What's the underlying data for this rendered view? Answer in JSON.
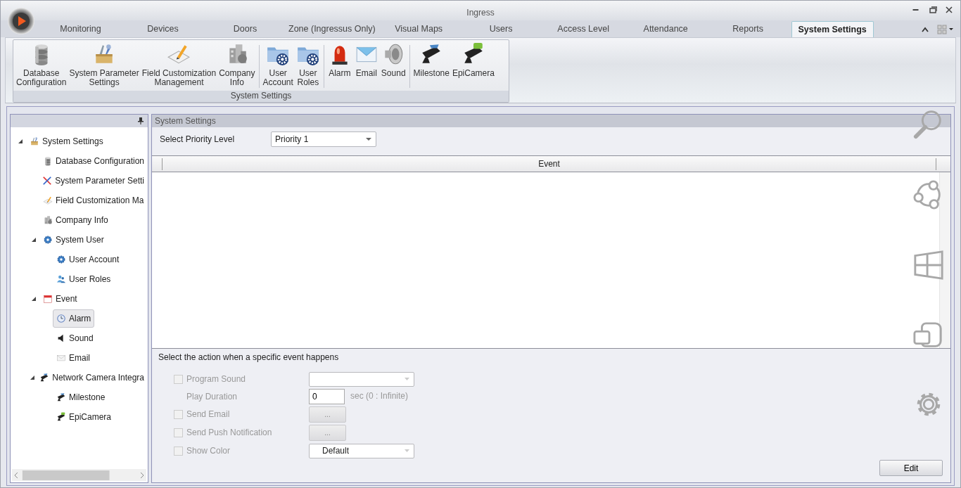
{
  "window": {
    "title": "Ingress"
  },
  "tabs": [
    {
      "label": "Monitoring",
      "selected": false
    },
    {
      "label": "Devices",
      "selected": false
    },
    {
      "label": "Doors",
      "selected": false
    },
    {
      "label": "Zone (Ingressus Only)",
      "selected": false
    },
    {
      "label": "Visual Maps",
      "selected": false
    },
    {
      "label": "Users",
      "selected": false
    },
    {
      "label": "Access Level",
      "selected": false
    },
    {
      "label": "Attendance",
      "selected": false
    },
    {
      "label": "Reports",
      "selected": false
    },
    {
      "label": "System Settings",
      "selected": true
    }
  ],
  "ribbon": {
    "groups": [
      {
        "items": [
          {
            "lines": [
              "Database",
              "Configuration"
            ]
          },
          {
            "lines": [
              "System Parameter",
              "Settings"
            ]
          },
          {
            "lines": [
              "Field Customization",
              "Management"
            ]
          },
          {
            "lines": [
              "Company",
              "Info"
            ]
          }
        ]
      },
      {
        "items": [
          {
            "lines": [
              "User",
              "Account"
            ]
          },
          {
            "lines": [
              "User",
              "Roles"
            ]
          }
        ]
      },
      {
        "items": [
          {
            "lines": [
              "Alarm"
            ]
          },
          {
            "lines": [
              "Email"
            ]
          },
          {
            "lines": [
              "Sound"
            ]
          }
        ]
      },
      {
        "items": [
          {
            "lines": [
              "Milestone"
            ]
          },
          {
            "lines": [
              "EpiCamera"
            ]
          }
        ]
      }
    ],
    "caption": "System Settings"
  },
  "tree": [
    {
      "label": "System Settings",
      "selected": false,
      "expanded": true,
      "children": [
        {
          "label": "Database Configuration",
          "selected": false
        },
        {
          "label": "System Parameter Setti",
          "selected": false
        },
        {
          "label": "Field Customization Ma",
          "selected": false
        },
        {
          "label": "Company Info",
          "selected": false
        },
        {
          "label": "System User",
          "selected": false,
          "expanded": true,
          "children": [
            {
              "label": "User Account",
              "selected": false
            },
            {
              "label": "User Roles",
              "selected": false
            }
          ]
        },
        {
          "label": "Event",
          "selected": false,
          "expanded": true,
          "children": [
            {
              "label": "Alarm",
              "selected": true
            },
            {
              "label": "Sound",
              "selected": false
            },
            {
              "label": "Email",
              "selected": false
            }
          ]
        },
        {
          "label": "Network Camera Integra",
          "selected": false,
          "expanded": true,
          "children": [
            {
              "label": "Milestone",
              "selected": false
            },
            {
              "label": "EpiCamera",
              "selected": false
            }
          ]
        }
      ]
    }
  ],
  "panel": {
    "title": "System Settings",
    "priority_label": "Select Priority Level",
    "priority_value": "Priority 1",
    "table": {
      "columns": [
        "Event"
      ]
    },
    "actions_heading": "Select the action when a specific event happens",
    "actions": [
      {
        "kind": "checkbox",
        "label": "Program Sound",
        "checked": false,
        "disabled": true,
        "control": {
          "kind": "select"
        }
      },
      {
        "kind": "field",
        "label": "Play Duration",
        "disabled": true,
        "value": "0",
        "suffix": "sec (0 : Infinite)"
      },
      {
        "kind": "checkbox",
        "label": "Send Email",
        "checked": false,
        "disabled": true,
        "control": {
          "kind": "button",
          "label": "..."
        }
      },
      {
        "kind": "checkbox",
        "label": "Send Push Notification",
        "checked": false,
        "disabled": true,
        "control": {
          "kind": "button",
          "label": "..."
        }
      },
      {
        "kind": "checkbox",
        "label": "Show Color",
        "checked": false,
        "disabled": true,
        "control": {
          "kind": "select",
          "value": "Default"
        }
      }
    ],
    "edit_button": "Edit"
  }
}
